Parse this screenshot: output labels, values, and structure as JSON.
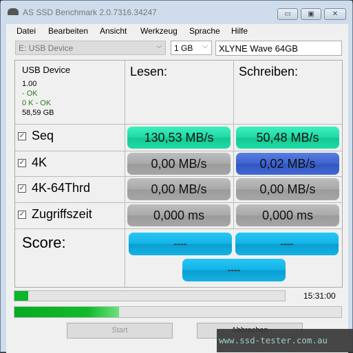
{
  "window": {
    "title": "AS SSD Benchmark 2.0.7316.34247",
    "minimize": "▭",
    "maximize": "▣",
    "close": "✕"
  },
  "menu": [
    "Datei",
    "Bearbeiten",
    "Ansicht",
    "Werkzeug",
    "Sprache",
    "Hilfe"
  ],
  "toolbar": {
    "drive": "E: USB Device",
    "size": "1 GB",
    "device_name": "XLYNE Wave 64GB"
  },
  "info": {
    "title": "USB Device",
    "firmware": "1.00",
    "driver_status": " - OK",
    "alignment": "0 K - OK",
    "capacity": "58,59 GB"
  },
  "columns": {
    "read": "Lesen:",
    "write": "Schreiben:"
  },
  "rows": [
    {
      "label": "Seq",
      "checked": true,
      "read": "130,53 MB/s",
      "write": "50,48 MB/s"
    },
    {
      "label": "4K",
      "checked": true,
      "read": "0,00 MB/s",
      "write": "0,02 MB/s"
    },
    {
      "label": "4K-64Thrd",
      "checked": true,
      "read": "0,00 MB/s",
      "write": "0,00 MB/s"
    },
    {
      "label": "Zugriffszeit",
      "checked": true,
      "read": "0,000 ms",
      "write": "0,000 ms"
    }
  ],
  "score": {
    "label": "Score:",
    "read": "----",
    "write": "----",
    "total": "----"
  },
  "progress": {
    "test_progress_pct": 5,
    "overall_progress_pct": 32,
    "time": "15:31:00"
  },
  "buttons": {
    "start": "Start",
    "cancel": "Abbrechen"
  },
  "watermark": "www.ssd-tester.com.au",
  "colors": {
    "seq_green": "#1ed9a4",
    "gray": "#a9a9a9",
    "blue": "#3d63cf",
    "score_blue": "#14b3e6",
    "progress_green": "#0fbb2a"
  }
}
